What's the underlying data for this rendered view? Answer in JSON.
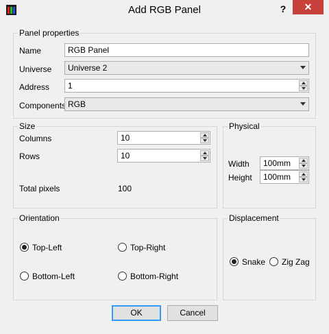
{
  "window": {
    "title": "Add RGB Panel",
    "help": "?",
    "close": "✕"
  },
  "panel_properties": {
    "title": "Panel properties",
    "name_label": "Name",
    "name_value": "RGB Panel",
    "universe_label": "Universe",
    "universe_value": "Universe 2",
    "address_label": "Address",
    "address_value": "1",
    "components_label": "Components",
    "components_value": "RGB"
  },
  "size": {
    "title": "Size",
    "columns_label": "Columns",
    "columns_value": "10",
    "rows_label": "Rows",
    "rows_value": "10",
    "total_label": "Total pixels",
    "total_value": "100"
  },
  "physical": {
    "title": "Physical",
    "width_label": "Width",
    "width_value": "100mm",
    "height_label": "Height",
    "height_value": "100mm"
  },
  "orientation": {
    "title": "Orientation",
    "options": [
      "Top-Left",
      "Top-Right",
      "Bottom-Left",
      "Bottom-Right"
    ],
    "selected": "Top-Left"
  },
  "displacement": {
    "title": "Displacement",
    "options": [
      "Snake",
      "Zig Zag"
    ],
    "selected": "Snake"
  },
  "buttons": {
    "ok": "OK",
    "cancel": "Cancel"
  }
}
